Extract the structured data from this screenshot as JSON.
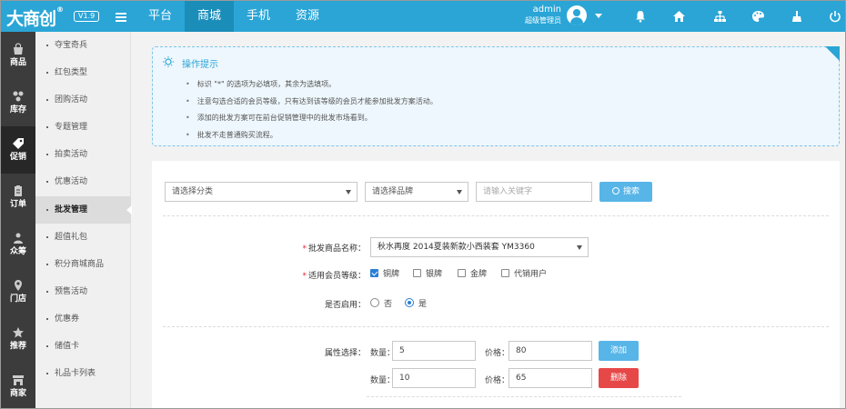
{
  "header": {
    "logo": "大商创",
    "logo_mark": "®",
    "version": "V1.9",
    "tabs": [
      {
        "label": "平台"
      },
      {
        "label": "商城"
      },
      {
        "label": "手机"
      },
      {
        "label": "资源"
      }
    ],
    "user_name": "admin",
    "user_role": "超级管理员",
    "icons": [
      "bell-icon",
      "home-icon",
      "sitemap-icon",
      "palette-icon",
      "broom-icon",
      "power-icon"
    ]
  },
  "iconbar": [
    {
      "label": "商品",
      "icon": "goods-icon"
    },
    {
      "label": "库存",
      "icon": "stock-icon"
    },
    {
      "label": "促销",
      "icon": "promotion-icon"
    },
    {
      "label": "订单",
      "icon": "order-icon"
    },
    {
      "label": "众筹",
      "icon": "crowdfunding-icon"
    },
    {
      "label": "门店",
      "icon": "store-icon"
    },
    {
      "label": "推荐",
      "icon": "star-icon"
    },
    {
      "label": "商家",
      "icon": "merchant-icon"
    }
  ],
  "submenu": [
    {
      "label": "夺宝奇兵"
    },
    {
      "label": "红包类型"
    },
    {
      "label": "团购活动"
    },
    {
      "label": "专题管理"
    },
    {
      "label": "拍卖活动"
    },
    {
      "label": "优惠活动"
    },
    {
      "label": "批发管理"
    },
    {
      "label": "超值礼包"
    },
    {
      "label": "积分商城商品"
    },
    {
      "label": "预售活动"
    },
    {
      "label": "优惠券"
    },
    {
      "label": "储值卡"
    },
    {
      "label": "礼品卡列表"
    }
  ],
  "tips": {
    "title": "操作提示",
    "items": [
      "标识 \"*\" 的选项为必填项，其余为选填项。",
      "注意勾选合适的会员等级，只有达到该等级的会员才能参加批发方案活动。",
      "添加的批发方案可在前台促销管理中的批发市场看到。",
      "批发不走普通购买流程。"
    ]
  },
  "search": {
    "category_placeholder": "请选择分类",
    "brand_placeholder": "请选择品牌",
    "keyword_placeholder": "请输入关键字",
    "search_label": "搜索"
  },
  "form": {
    "product_label": "批发商品名称：",
    "product_value": "秋水再度 2014夏装新款小西装套 YM3360",
    "member_label": "适用会员等级：",
    "member_levels": [
      {
        "label": "铜牌",
        "checked": true
      },
      {
        "label": "银牌",
        "checked": false
      },
      {
        "label": "金牌",
        "checked": false
      },
      {
        "label": "代销用户",
        "checked": false
      }
    ],
    "enable_label": "是否启用：",
    "enable_options": [
      {
        "label": "否",
        "selected": false
      },
      {
        "label": "是",
        "selected": true
      }
    ],
    "attr_label": "属性选择：",
    "qty_label": "数量：",
    "price_label": "价格：",
    "rows": [
      {
        "qty": "5",
        "price": "80",
        "action": "添加"
      },
      {
        "qty": "10",
        "price": "65",
        "action": "删除"
      }
    ]
  },
  "colors": {
    "topbar": "#2aa5d6",
    "sidebar": "#3c3c3c",
    "button_blue": "#57b5e8",
    "button_red": "#e64848"
  }
}
